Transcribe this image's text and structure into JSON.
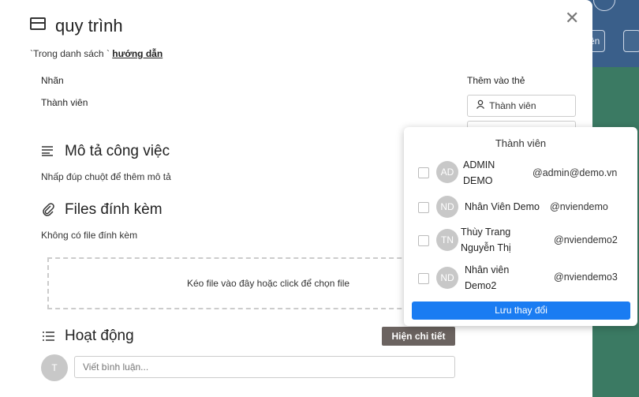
{
  "card": {
    "title": "quy trình",
    "list_prefix": "`Trong danh sách `",
    "list_name": "hướng dẫn",
    "labels_label": "Nhãn",
    "members_label": "Thành viên"
  },
  "sidebar": {
    "add_to_card": "Thêm vào thẻ",
    "members_button": "Thành viên"
  },
  "description": {
    "title": "Mô tả công việc",
    "placeholder": "Nhấp đúp chuột để thêm mô tả"
  },
  "attachments": {
    "title": "Files đính kèm",
    "empty": "Không có file đính kèm",
    "dropzone": "Kéo file vào đây hoặc click để chọn file"
  },
  "activity": {
    "title": "Hoạt động",
    "detail_button": "Hiện chi tiết",
    "avatar": "T",
    "comment_placeholder": "Viết bình luận..."
  },
  "members_popup": {
    "title": "Thành viên",
    "members": [
      {
        "initials": "AD",
        "name_line1": "ADMIN",
        "name_line2": "DEMO",
        "username": "@admin@demo.vn"
      },
      {
        "initials": "ND",
        "name_line1": "Nhân Viên Demo",
        "name_line2": "",
        "username": "@nviendemo"
      },
      {
        "initials": "TN",
        "name_line1": "Thùy Trang",
        "name_line2": "Nguyễn Thị",
        "username": "@nviendemo2"
      },
      {
        "initials": "ND",
        "name_line1": "Nhân viên",
        "name_line2": "Demo2",
        "username": "@nviendemo3"
      }
    ],
    "save_button": "Lưu thay đổi"
  },
  "background": {
    "button_1": "ên"
  },
  "colors": {
    "primary": "#1a7cf2",
    "detail_button": "#6b6360",
    "board_bg": "#2f6e5c"
  }
}
